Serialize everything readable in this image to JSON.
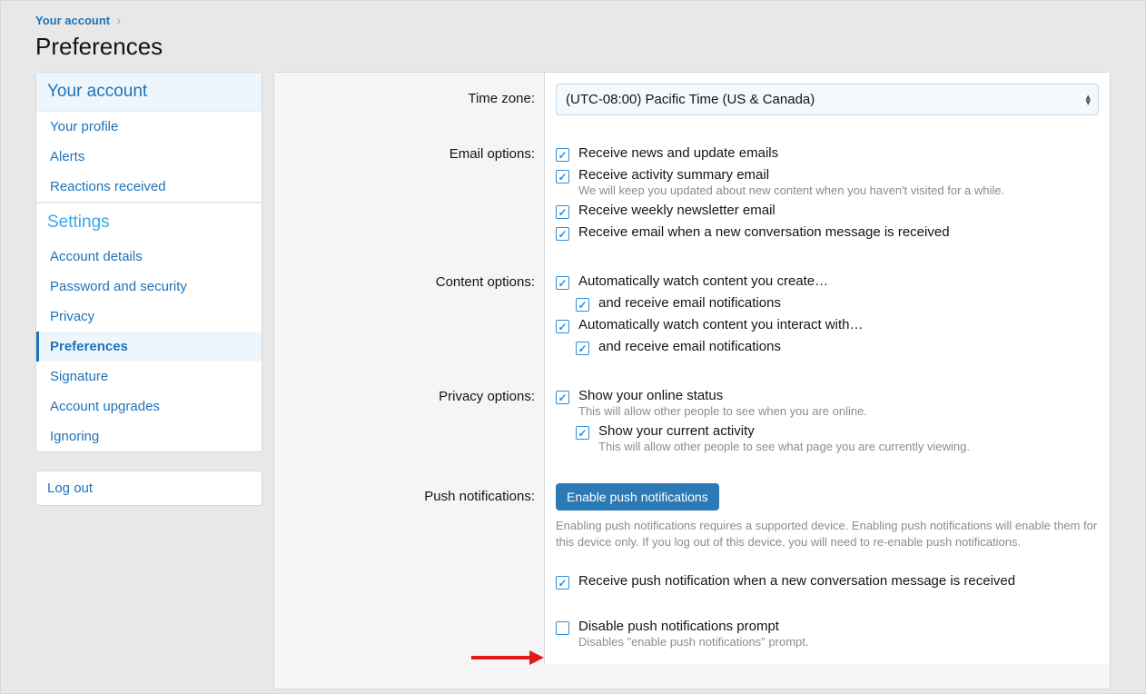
{
  "breadcrumb": {
    "parent": "Your account"
  },
  "page_title": "Preferences",
  "sidebar": {
    "section1_title": "Your account",
    "section1_items": [
      "Your profile",
      "Alerts",
      "Reactions received"
    ],
    "section2_title": "Settings",
    "section2_items": [
      "Account details",
      "Password and security",
      "Privacy",
      "Preferences",
      "Signature",
      "Account upgrades",
      "Ignoring"
    ],
    "selected": "Preferences",
    "logout": "Log out"
  },
  "form": {
    "timezone": {
      "label": "Time zone:",
      "value": "(UTC-08:00) Pacific Time (US & Canada)"
    },
    "email": {
      "label": "Email options:",
      "opt1": "Receive news and update emails",
      "opt2": "Receive activity summary email",
      "opt2_desc": "We will keep you updated about new content when you haven't visited for a while.",
      "opt3": "Receive weekly newsletter email",
      "opt4": "Receive email when a new conversation message is received"
    },
    "content": {
      "label": "Content options:",
      "opt1": "Automatically watch content you create…",
      "opt1_sub": "and receive email notifications",
      "opt2": "Automatically watch content you interact with…",
      "opt2_sub": "and receive email notifications"
    },
    "privacy": {
      "label": "Privacy options:",
      "opt1": "Show your online status",
      "opt1_desc": "This will allow other people to see when you are online.",
      "opt2": "Show your current activity",
      "opt2_desc": "This will allow other people to see what page you are currently viewing."
    },
    "push": {
      "label": "Push notifications:",
      "button": "Enable push notifications",
      "desc": "Enabling push notifications requires a supported device. Enabling push notifications will enable them for this device only. If you log out of this device, you will need to re-enable push notifications.",
      "opt1": "Receive push notification when a new conversation message is received",
      "opt2": "Disable push notifications prompt",
      "opt2_desc": "Disables \"enable push notifications\" prompt."
    }
  }
}
